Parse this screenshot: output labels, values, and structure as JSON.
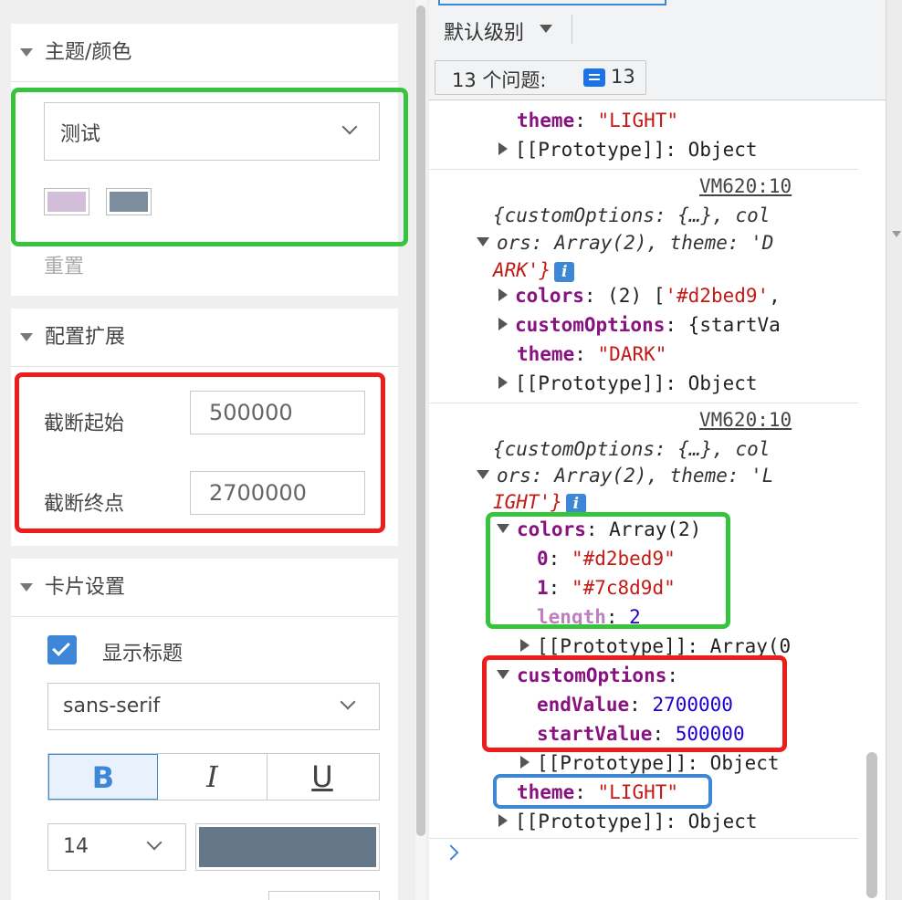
{
  "left_panel": {
    "theme_section": {
      "title": "主题/颜色",
      "theme_select": "测试",
      "swatches": [
        "#d2bed9",
        "#7c8d9d"
      ],
      "reset": "重置"
    },
    "config_section": {
      "title": "配置扩展",
      "start_label": "截断起始",
      "start_value": "500000",
      "end_label": "截断终点",
      "end_value": "2700000"
    },
    "card_section": {
      "title": "卡片设置",
      "show_title_label": "显示标题",
      "show_title_checked": true,
      "font_family": "sans-serif",
      "bold": "B",
      "italic": "I",
      "underline": "U",
      "font_size": "14",
      "font_color": "#67778a"
    }
  },
  "console": {
    "toolbar": {
      "level_label": "默认级别",
      "issues_label": "13 个问题:",
      "issues_count": "13"
    },
    "entry1": {
      "theme_key": "theme",
      "theme_val": "\"LIGHT\"",
      "proto": "[[Prototype]]",
      "proto_val": "Object"
    },
    "entry2": {
      "source": "VM620:10",
      "summary1": "{customOptions: {…}, col",
      "summary2": "ors: Array(2), theme: 'D",
      "summary3": "ARK'}",
      "colors_key": "colors",
      "colors_val": "(2) [",
      "colors_first": "'#d2bed9'",
      "colors_tail": ",",
      "custom_key": "customOptions",
      "custom_val": "{startVa",
      "theme_key": "theme",
      "theme_val": "\"DARK\"",
      "proto": "[[Prototype]]",
      "proto_val": "Object"
    },
    "entry3": {
      "source": "VM620:10",
      "summary1": "{customOptions: {…}, col",
      "summary2": "ors: Array(2), theme: 'L",
      "summary3": "IGHT'}",
      "colors_key": "colors",
      "colors_val": "Array(2)",
      "c0_key": "0",
      "c0_val": "\"#d2bed9\"",
      "c1_key": "1",
      "c1_val": "\"#7c8d9d\"",
      "len_key": "length",
      "len_val": "2",
      "proto_arr": "[[Prototype]]",
      "proto_arr_val": "Array(0",
      "custom_key": "customOptions",
      "end_key": "endValue",
      "end_val": "2700000",
      "start_key": "startValue",
      "start_val": "500000",
      "proto_obj": "[[Prototype]]",
      "proto_obj_val": "Object",
      "theme_key": "theme",
      "theme_val": "\"LIGHT\"",
      "proto": "[[Prototype]]",
      "proto_val": "Object"
    }
  }
}
